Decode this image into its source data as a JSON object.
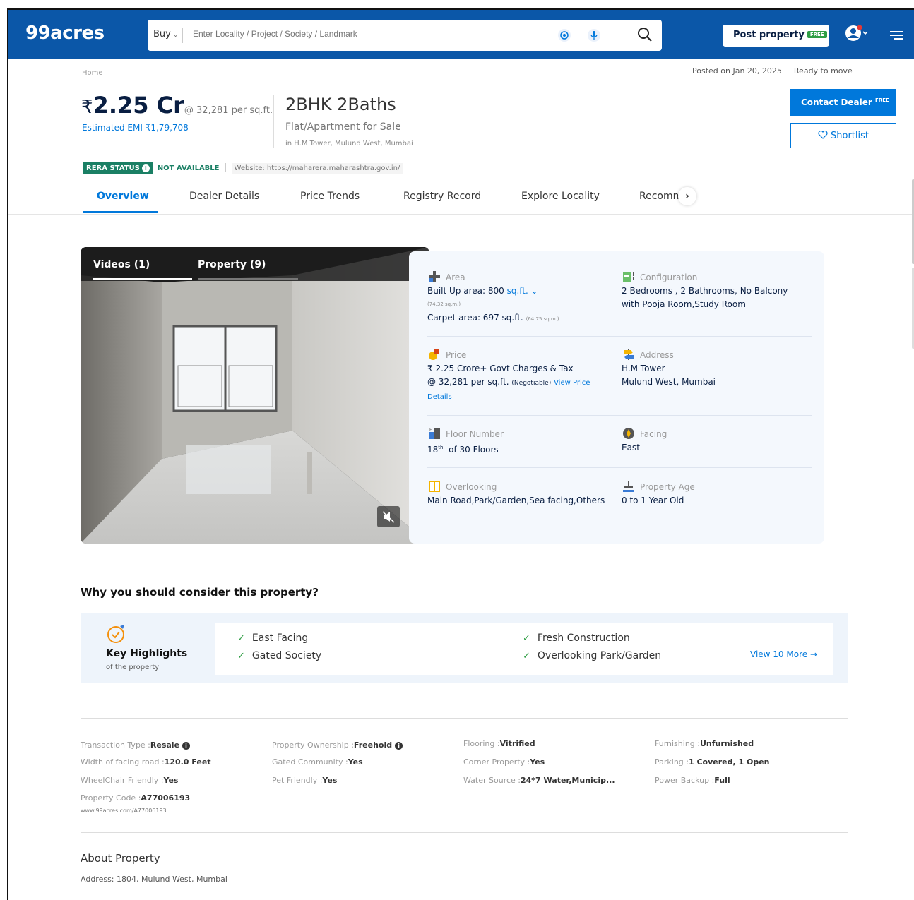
{
  "header": {
    "logo": "99acres",
    "buy_label": "Buy",
    "search_placeholder": "Enter Locality / Project / Society / Landmark",
    "post_property_label": "Post property",
    "free_tag": "FREE",
    "brand_color": "#0B57A8"
  },
  "breadcrumb": "Home",
  "posted_on": "Posted on Jan 20, 2025",
  "status": "Ready to move",
  "price": {
    "rupee": "₹",
    "value": "2.25 Cr",
    "per_sqft": "@ 32,281 per sq.ft.",
    "emi": "Estimated EMI ₹1,79,708"
  },
  "title": {
    "bhk": "2BHK 2Baths",
    "type": "Flat/Apartment for Sale",
    "address": "in H.M Tower, Mulund West, Mumbai"
  },
  "buttons": {
    "contact": "Contact Dealer",
    "contact_free": "FREE",
    "shortlist": "Shortlist"
  },
  "rera": {
    "badge": "RERA STATUS",
    "status": "NOT AVAILABLE",
    "website": "Website: https://maharera.maharashtra.gov.in/"
  },
  "tabs": [
    "Overview",
    "Dealer Details",
    "Price Trends",
    "Registry Record",
    "Explore Locality",
    "Recomn"
  ],
  "media": {
    "videos_tab": "Videos (1)",
    "property_tab": "Property (9)"
  },
  "details": {
    "area_label": "Area",
    "built_up": "Built Up area: 800",
    "built_up_unit": "sq.ft.",
    "built_up_sqm": "(74.32 sq.m.)",
    "carpet": "Carpet area: 697 sq.ft.",
    "carpet_sqm": "(64.75 sq.m.)",
    "config_label": "Configuration",
    "config_line1": "2 Bedrooms , 2 Bathrooms, No Balcony",
    "config_line2": "with Pooja Room,Study Room",
    "price_label": "Price",
    "price_line1": "₹ 2.25 Crore+ Govt Charges & Tax",
    "price_line2": "@ 32,281 per sq.ft.",
    "negotiable": "(Negotiable)",
    "view_price": "View Price",
    "view_price2": "Details",
    "address_label": "Address",
    "address_line1": "H.M Tower",
    "address_line2": "Mulund West, Mumbai",
    "floor_label": "Floor Number",
    "floor_num": "18",
    "floor_sup": "th",
    "floor_rest": "of 30 Floors",
    "facing_label": "Facing",
    "facing_value": "East",
    "overlooking_label": "Overlooking",
    "overlooking_value": "Main Road,Park/Garden,Sea facing,Others",
    "age_label": "Property Age",
    "age_value": "0 to 1 Year Old"
  },
  "why": {
    "title": "Why you should consider this property?",
    "kh_title": "Key Highlights",
    "kh_sub": "of the property",
    "highlights": [
      "East Facing",
      "Gated Society",
      "Fresh Construction",
      "Overlooking Park/Garden"
    ],
    "view_more": "View 10 More →"
  },
  "facts": {
    "transaction_label": "Transaction Type :",
    "transaction_value": "Resale",
    "ownership_label": "Property Ownership :",
    "ownership_value": "Freehold",
    "flooring_label": "Flooring :",
    "flooring_value": "Vitrified",
    "furnishing_label": "Furnishing :",
    "furnishing_value": "Unfurnished",
    "road_label": "Width of facing road :",
    "road_value": "120.0 Feet",
    "gated_label": "Gated Community :",
    "gated_value": "Yes",
    "corner_label": "Corner Property :",
    "corner_value": "Yes",
    "parking_label": "Parking :",
    "parking_value": "1 Covered, 1 Open",
    "wheelchair_label": "WheelChair Friendly :",
    "wheelchair_value": "Yes",
    "pet_label": "Pet Friendly :",
    "pet_value": "Yes",
    "water_label": "Water Source :",
    "water_value": "24*7 Water,Municip...",
    "power_label": "Power Backup :",
    "power_value": "Full",
    "code_label": "Property Code :",
    "code_value": "A77006193",
    "code_url": "www.99acres.com/A77006193"
  },
  "about": {
    "title": "About Property",
    "address": "Address: 1804, Mulund West, Mumbai"
  }
}
